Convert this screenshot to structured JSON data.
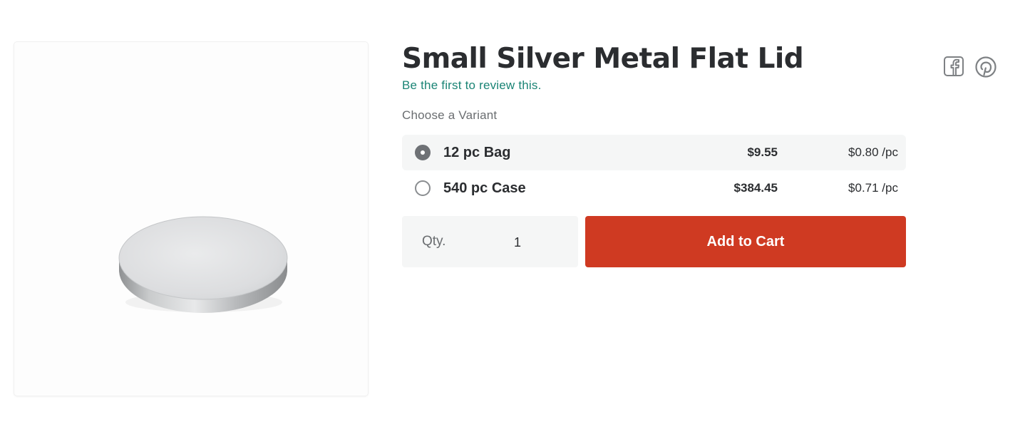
{
  "product": {
    "title": "Small Silver Metal Flat Lid",
    "review_link": "Be the first to review this."
  },
  "variants": {
    "label": "Choose a Variant",
    "options": [
      {
        "name": "12 pc Bag",
        "price": "$9.55",
        "unit_price": "$0.80 /pc",
        "selected": true
      },
      {
        "name": "540 pc Case",
        "price": "$384.45",
        "unit_price": "$0.71 /pc",
        "selected": false
      }
    ]
  },
  "purchase": {
    "qty_label": "Qty.",
    "qty_value": "1",
    "add_to_cart_label": "Add to Cart"
  },
  "social": {
    "icons": [
      "facebook-icon",
      "pinterest-icon"
    ]
  },
  "colors": {
    "accent": "#cf3a22",
    "link": "#1a8475"
  }
}
